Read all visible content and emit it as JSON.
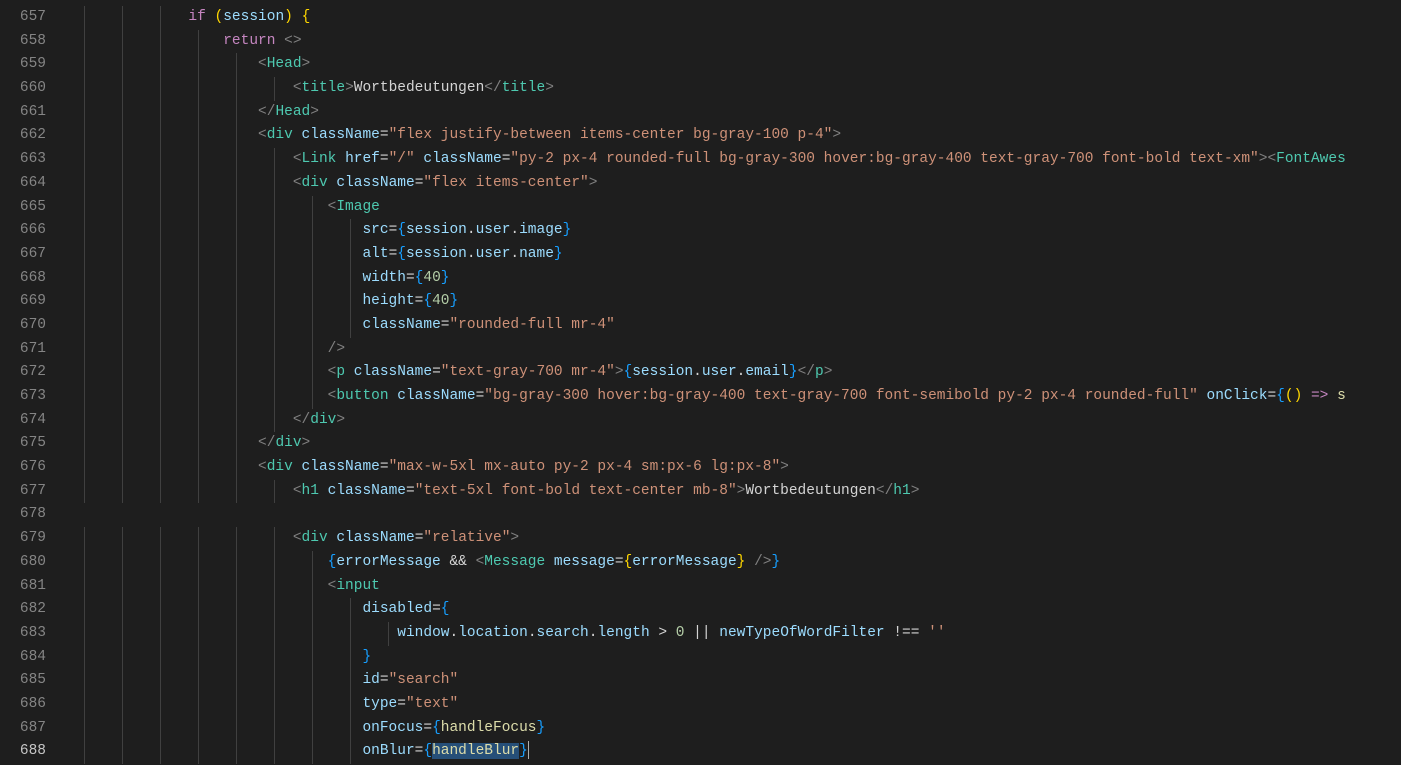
{
  "editor": {
    "startLine": 657,
    "endLine": 688,
    "currentLine": 688,
    "lines": {
      "657": [
        {
          "t": "ind",
          "n": 3
        },
        {
          "t": "keyword",
          "v": "if"
        },
        {
          "t": "text",
          "v": " "
        },
        {
          "t": "yellowb",
          "v": "("
        },
        {
          "t": "var",
          "v": "session"
        },
        {
          "t": "yellowb",
          "v": ")"
        },
        {
          "t": "text",
          "v": " "
        },
        {
          "t": "yellowb",
          "v": "{"
        }
      ],
      "658": [
        {
          "t": "ind",
          "n": 4
        },
        {
          "t": "keyword",
          "v": "return"
        },
        {
          "t": "text",
          "v": " "
        },
        {
          "t": "jsxp",
          "v": "<>"
        }
      ],
      "659": [
        {
          "t": "ind",
          "n": 5
        },
        {
          "t": "jsxp",
          "v": "<"
        },
        {
          "t": "tag",
          "v": "Head"
        },
        {
          "t": "jsxp",
          "v": ">"
        }
      ],
      "660": [
        {
          "t": "ind",
          "n": 6
        },
        {
          "t": "jsxp",
          "v": "<"
        },
        {
          "t": "tag",
          "v": "title"
        },
        {
          "t": "jsxp",
          "v": ">"
        },
        {
          "t": "text",
          "v": "Wortbedeutungen"
        },
        {
          "t": "jsxp",
          "v": "</"
        },
        {
          "t": "tag",
          "v": "title"
        },
        {
          "t": "jsxp",
          "v": ">"
        }
      ],
      "661": [
        {
          "t": "ind",
          "n": 5
        },
        {
          "t": "jsxp",
          "v": "</"
        },
        {
          "t": "tag",
          "v": "Head"
        },
        {
          "t": "jsxp",
          "v": ">"
        }
      ],
      "662": [
        {
          "t": "ind",
          "n": 5
        },
        {
          "t": "jsxp",
          "v": "<"
        },
        {
          "t": "tag",
          "v": "div"
        },
        {
          "t": "text",
          "v": " "
        },
        {
          "t": "attr",
          "v": "className"
        },
        {
          "t": "text",
          "v": "="
        },
        {
          "t": "string",
          "v": "\"flex justify-between items-center bg-gray-100 p-4\""
        },
        {
          "t": "jsxp",
          "v": ">"
        }
      ],
      "663": [
        {
          "t": "ind",
          "n": 6
        },
        {
          "t": "jsxp",
          "v": "<"
        },
        {
          "t": "tag",
          "v": "Link"
        },
        {
          "t": "text",
          "v": " "
        },
        {
          "t": "attr",
          "v": "href"
        },
        {
          "t": "text",
          "v": "="
        },
        {
          "t": "string",
          "v": "\"/\""
        },
        {
          "t": "text",
          "v": " "
        },
        {
          "t": "attr",
          "v": "className"
        },
        {
          "t": "text",
          "v": "="
        },
        {
          "t": "string",
          "v": "\"py-2 px-4 rounded-full bg-gray-300 hover:bg-gray-400 text-gray-700 font-bold text-xm\""
        },
        {
          "t": "jsxp",
          "v": ">"
        },
        {
          "t": "jsxp",
          "v": "<"
        },
        {
          "t": "tag",
          "v": "FontAwes"
        }
      ],
      "664": [
        {
          "t": "ind",
          "n": 6
        },
        {
          "t": "jsxp",
          "v": "<"
        },
        {
          "t": "tag",
          "v": "div"
        },
        {
          "t": "text",
          "v": " "
        },
        {
          "t": "attr",
          "v": "className"
        },
        {
          "t": "text",
          "v": "="
        },
        {
          "t": "string",
          "v": "\"flex items-center\""
        },
        {
          "t": "jsxp",
          "v": ">"
        }
      ],
      "665": [
        {
          "t": "ind",
          "n": 7
        },
        {
          "t": "jsxp",
          "v": "<"
        },
        {
          "t": "tag",
          "v": "Image"
        }
      ],
      "666": [
        {
          "t": "ind",
          "n": 8
        },
        {
          "t": "attr",
          "v": "src"
        },
        {
          "t": "text",
          "v": "="
        },
        {
          "t": "blueb",
          "v": "{"
        },
        {
          "t": "var",
          "v": "session"
        },
        {
          "t": "text",
          "v": "."
        },
        {
          "t": "var",
          "v": "user"
        },
        {
          "t": "text",
          "v": "."
        },
        {
          "t": "var",
          "v": "image"
        },
        {
          "t": "blueb",
          "v": "}"
        }
      ],
      "667": [
        {
          "t": "ind",
          "n": 8
        },
        {
          "t": "attr",
          "v": "alt"
        },
        {
          "t": "text",
          "v": "="
        },
        {
          "t": "blueb",
          "v": "{"
        },
        {
          "t": "var",
          "v": "session"
        },
        {
          "t": "text",
          "v": "."
        },
        {
          "t": "var",
          "v": "user"
        },
        {
          "t": "text",
          "v": "."
        },
        {
          "t": "var",
          "v": "name"
        },
        {
          "t": "blueb",
          "v": "}"
        }
      ],
      "668": [
        {
          "t": "ind",
          "n": 8
        },
        {
          "t": "attr",
          "v": "width"
        },
        {
          "t": "text",
          "v": "="
        },
        {
          "t": "blueb",
          "v": "{"
        },
        {
          "t": "num",
          "v": "40"
        },
        {
          "t": "blueb",
          "v": "}"
        }
      ],
      "669": [
        {
          "t": "ind",
          "n": 8
        },
        {
          "t": "attr",
          "v": "height"
        },
        {
          "t": "text",
          "v": "="
        },
        {
          "t": "blueb",
          "v": "{"
        },
        {
          "t": "num",
          "v": "40"
        },
        {
          "t": "blueb",
          "v": "}"
        }
      ],
      "670": [
        {
          "t": "ind",
          "n": 8
        },
        {
          "t": "attr",
          "v": "className"
        },
        {
          "t": "text",
          "v": "="
        },
        {
          "t": "string",
          "v": "\"rounded-full mr-4\""
        }
      ],
      "671": [
        {
          "t": "ind",
          "n": 7
        },
        {
          "t": "jsxp",
          "v": "/>"
        }
      ],
      "672": [
        {
          "t": "ind",
          "n": 7
        },
        {
          "t": "jsxp",
          "v": "<"
        },
        {
          "t": "tag",
          "v": "p"
        },
        {
          "t": "text",
          "v": " "
        },
        {
          "t": "attr",
          "v": "className"
        },
        {
          "t": "text",
          "v": "="
        },
        {
          "t": "string",
          "v": "\"text-gray-700 mr-4\""
        },
        {
          "t": "jsxp",
          "v": ">"
        },
        {
          "t": "blueb",
          "v": "{"
        },
        {
          "t": "var",
          "v": "session"
        },
        {
          "t": "text",
          "v": "."
        },
        {
          "t": "var",
          "v": "user"
        },
        {
          "t": "text",
          "v": "."
        },
        {
          "t": "var",
          "v": "email"
        },
        {
          "t": "blueb",
          "v": "}"
        },
        {
          "t": "jsxp",
          "v": "</"
        },
        {
          "t": "tag",
          "v": "p"
        },
        {
          "t": "jsxp",
          "v": ">"
        }
      ],
      "673": [
        {
          "t": "ind",
          "n": 7
        },
        {
          "t": "jsxp",
          "v": "<"
        },
        {
          "t": "tag",
          "v": "button"
        },
        {
          "t": "text",
          "v": " "
        },
        {
          "t": "attr",
          "v": "className"
        },
        {
          "t": "text",
          "v": "="
        },
        {
          "t": "string",
          "v": "\"bg-gray-300 hover:bg-gray-400 text-gray-700 font-semibold py-2 px-4 rounded-full\""
        },
        {
          "t": "text",
          "v": " "
        },
        {
          "t": "attr",
          "v": "onClick"
        },
        {
          "t": "text",
          "v": "="
        },
        {
          "t": "blueb",
          "v": "{"
        },
        {
          "t": "yellowb",
          "v": "("
        },
        {
          "t": "yellowb",
          "v": ")"
        },
        {
          "t": "text",
          "v": " "
        },
        {
          "t": "keyword",
          "v": "=>"
        },
        {
          "t": "text",
          "v": " "
        },
        {
          "t": "func",
          "v": "s"
        }
      ],
      "674": [
        {
          "t": "ind",
          "n": 6
        },
        {
          "t": "jsxp",
          "v": "</"
        },
        {
          "t": "tag",
          "v": "div"
        },
        {
          "t": "jsxp",
          "v": ">"
        }
      ],
      "675": [
        {
          "t": "ind",
          "n": 5
        },
        {
          "t": "jsxp",
          "v": "</"
        },
        {
          "t": "tag",
          "v": "div"
        },
        {
          "t": "jsxp",
          "v": ">"
        }
      ],
      "676": [
        {
          "t": "ind",
          "n": 5
        },
        {
          "t": "jsxp",
          "v": "<"
        },
        {
          "t": "tag",
          "v": "div"
        },
        {
          "t": "text",
          "v": " "
        },
        {
          "t": "attr",
          "v": "className"
        },
        {
          "t": "text",
          "v": "="
        },
        {
          "t": "string",
          "v": "\"max-w-5xl mx-auto py-2 px-4 sm:px-6 lg:px-8\""
        },
        {
          "t": "jsxp",
          "v": ">"
        }
      ],
      "677": [
        {
          "t": "ind",
          "n": 6
        },
        {
          "t": "jsxp",
          "v": "<"
        },
        {
          "t": "tag",
          "v": "h1"
        },
        {
          "t": "text",
          "v": " "
        },
        {
          "t": "attr",
          "v": "className"
        },
        {
          "t": "text",
          "v": "="
        },
        {
          "t": "string",
          "v": "\"text-5xl font-bold text-center mb-8\""
        },
        {
          "t": "jsxp",
          "v": ">"
        },
        {
          "t": "text",
          "v": "Wortbedeutungen"
        },
        {
          "t": "jsxp",
          "v": "</"
        },
        {
          "t": "tag",
          "v": "h1"
        },
        {
          "t": "jsxp",
          "v": ">"
        }
      ],
      "678": [
        {
          "t": "ind",
          "n": 0
        }
      ],
      "679": [
        {
          "t": "ind",
          "n": 6
        },
        {
          "t": "jsxp",
          "v": "<"
        },
        {
          "t": "tag",
          "v": "div"
        },
        {
          "t": "text",
          "v": " "
        },
        {
          "t": "attr",
          "v": "className"
        },
        {
          "t": "text",
          "v": "="
        },
        {
          "t": "string",
          "v": "\"relative\""
        },
        {
          "t": "jsxp",
          "v": ">"
        }
      ],
      "680": [
        {
          "t": "ind",
          "n": 7
        },
        {
          "t": "blueb",
          "v": "{"
        },
        {
          "t": "var",
          "v": "errorMessage"
        },
        {
          "t": "text",
          "v": " "
        },
        {
          "t": "text",
          "v": "&&"
        },
        {
          "t": "text",
          "v": " "
        },
        {
          "t": "jsxp",
          "v": "<"
        },
        {
          "t": "tag",
          "v": "Message"
        },
        {
          "t": "text",
          "v": " "
        },
        {
          "t": "attr",
          "v": "message"
        },
        {
          "t": "text",
          "v": "="
        },
        {
          "t": "yellowb",
          "v": "{"
        },
        {
          "t": "var",
          "v": "errorMessage"
        },
        {
          "t": "yellowb",
          "v": "}"
        },
        {
          "t": "text",
          "v": " "
        },
        {
          "t": "jsxp",
          "v": "/>"
        },
        {
          "t": "blueb",
          "v": "}"
        }
      ],
      "681": [
        {
          "t": "ind",
          "n": 7
        },
        {
          "t": "jsxp",
          "v": "<"
        },
        {
          "t": "tag",
          "v": "input"
        }
      ],
      "682": [
        {
          "t": "ind",
          "n": 8
        },
        {
          "t": "attr",
          "v": "disabled"
        },
        {
          "t": "text",
          "v": "="
        },
        {
          "t": "blueb",
          "v": "{"
        }
      ],
      "683": [
        {
          "t": "ind",
          "n": 9
        },
        {
          "t": "var",
          "v": "window"
        },
        {
          "t": "text",
          "v": "."
        },
        {
          "t": "var",
          "v": "location"
        },
        {
          "t": "text",
          "v": "."
        },
        {
          "t": "var",
          "v": "search"
        },
        {
          "t": "text",
          "v": "."
        },
        {
          "t": "var",
          "v": "length"
        },
        {
          "t": "text",
          "v": " > "
        },
        {
          "t": "num",
          "v": "0"
        },
        {
          "t": "text",
          "v": " || "
        },
        {
          "t": "var",
          "v": "newTypeOfWordFilter"
        },
        {
          "t": "text",
          "v": " !== "
        },
        {
          "t": "string",
          "v": "''"
        }
      ],
      "684": [
        {
          "t": "ind",
          "n": 8
        },
        {
          "t": "blueb",
          "v": "}"
        }
      ],
      "685": [
        {
          "t": "ind",
          "n": 8
        },
        {
          "t": "attr",
          "v": "id"
        },
        {
          "t": "text",
          "v": "="
        },
        {
          "t": "string",
          "v": "\"search\""
        }
      ],
      "686": [
        {
          "t": "ind",
          "n": 8
        },
        {
          "t": "attr",
          "v": "type"
        },
        {
          "t": "text",
          "v": "="
        },
        {
          "t": "string",
          "v": "\"text\""
        }
      ],
      "687": [
        {
          "t": "ind",
          "n": 8
        },
        {
          "t": "attr",
          "v": "onFocus"
        },
        {
          "t": "text",
          "v": "="
        },
        {
          "t": "blueb",
          "v": "{"
        },
        {
          "t": "func",
          "v": "handleFocus"
        },
        {
          "t": "blueb",
          "v": "}"
        }
      ],
      "688": [
        {
          "t": "ind",
          "n": 8
        },
        {
          "t": "attr",
          "v": "onBlur"
        },
        {
          "t": "text",
          "v": "="
        },
        {
          "t": "blueb",
          "v": "{"
        },
        {
          "t": "func",
          "v": "handleBlur",
          "sel": true
        },
        {
          "t": "blueb",
          "v": "}"
        },
        {
          "t": "cursor",
          "v": ""
        }
      ]
    }
  }
}
